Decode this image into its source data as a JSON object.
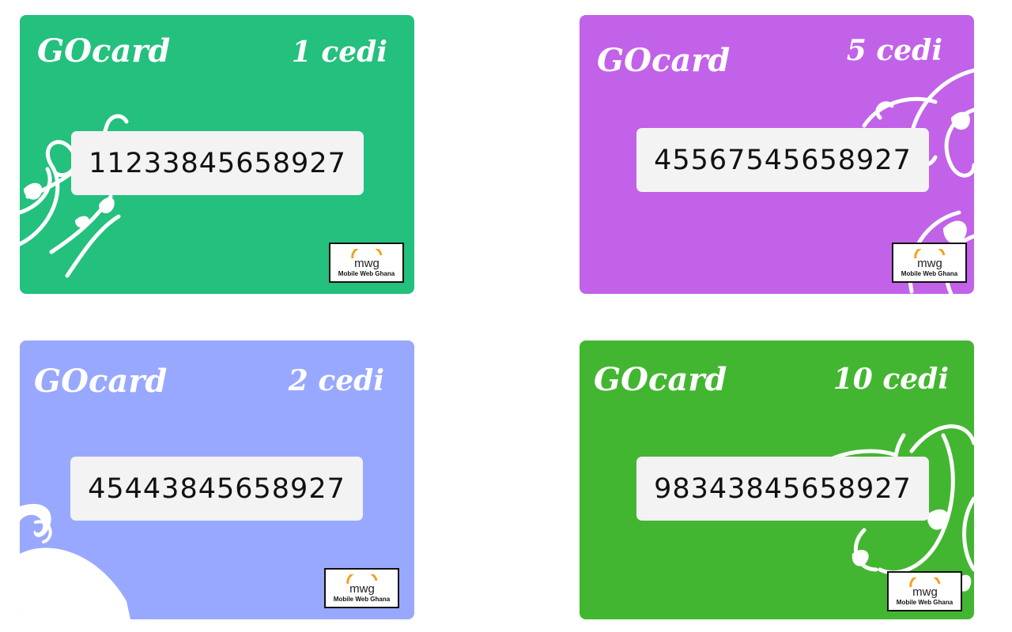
{
  "cards": [
    {
      "brand": "GOcard",
      "denomination": "1 cedi",
      "pin": "11233845658927",
      "color": "#23c07e",
      "logo_mark": "mwg",
      "logo_text": "Mobile Web Ghana"
    },
    {
      "brand": "GOcard",
      "denomination": "5 cedi",
      "pin": "45567545658927",
      "color": "#c262e8",
      "logo_mark": "mwg",
      "logo_text": "Mobile Web Ghana"
    },
    {
      "brand": "GOcard",
      "denomination": "2 cedi",
      "pin": "45443845658927",
      "color": "#99a8ff",
      "logo_mark": "mwg",
      "logo_text": "Mobile Web Ghana"
    },
    {
      "brand": "GOcard",
      "denomination": "10 cedi",
      "pin": "98343845658927",
      "color": "#43b631",
      "logo_mark": "mwg",
      "logo_text": "Mobile Web Ghana"
    }
  ],
  "colors": {
    "pin_background": "#f3f3f3",
    "logo_accent": "#f2a11f"
  }
}
